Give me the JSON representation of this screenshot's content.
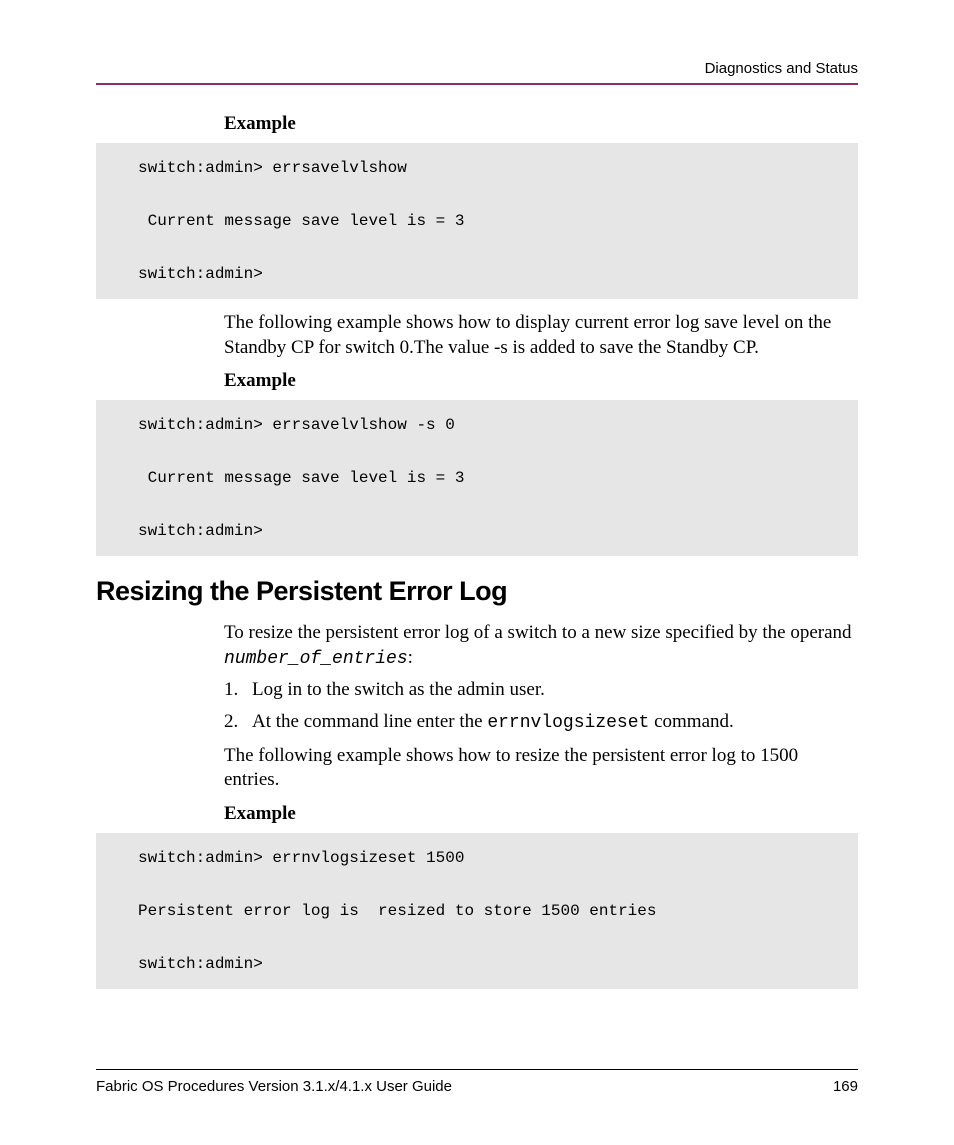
{
  "header": {
    "section_title": "Diagnostics and Status"
  },
  "body": {
    "example_label_1": "Example",
    "code_block_1": "switch:admin> errsavelvlshow\n\n Current message save level is = 3\n\nswitch:admin>",
    "para_1": "The following example shows how to display current error log save level on the Standby CP for switch 0.The value -s is added to save the Standby CP.",
    "example_label_2": "Example",
    "code_block_2": "switch:admin> errsavelvlshow -s 0\n\n Current message save level is = 3\n\nswitch:admin>",
    "section_heading": "Resizing the Persistent Error Log",
    "para_2_pre": "To resize the persistent error log of a switch to a new size specified by the operand ",
    "para_2_code": "number_of_entries",
    "para_2_post": ":",
    "list": {
      "item1_num": "1.",
      "item1_text": "Log in to the switch as the admin user.",
      "item2_num": "2.",
      "item2_pre": "At the command line enter the ",
      "item2_code": "errnvlogsizeset",
      "item2_post": " command."
    },
    "para_3": "The following example shows how to resize the persistent error log to 1500 entries.",
    "example_label_3": "Example",
    "code_block_3": "switch:admin> errnvlogsizeset 1500\n\nPersistent error log is  resized to store 1500 entries\n\nswitch:admin>"
  },
  "footer": {
    "guide_title": "Fabric OS Procedures Version 3.1.x/4.1.x User Guide",
    "page_number": "169"
  }
}
